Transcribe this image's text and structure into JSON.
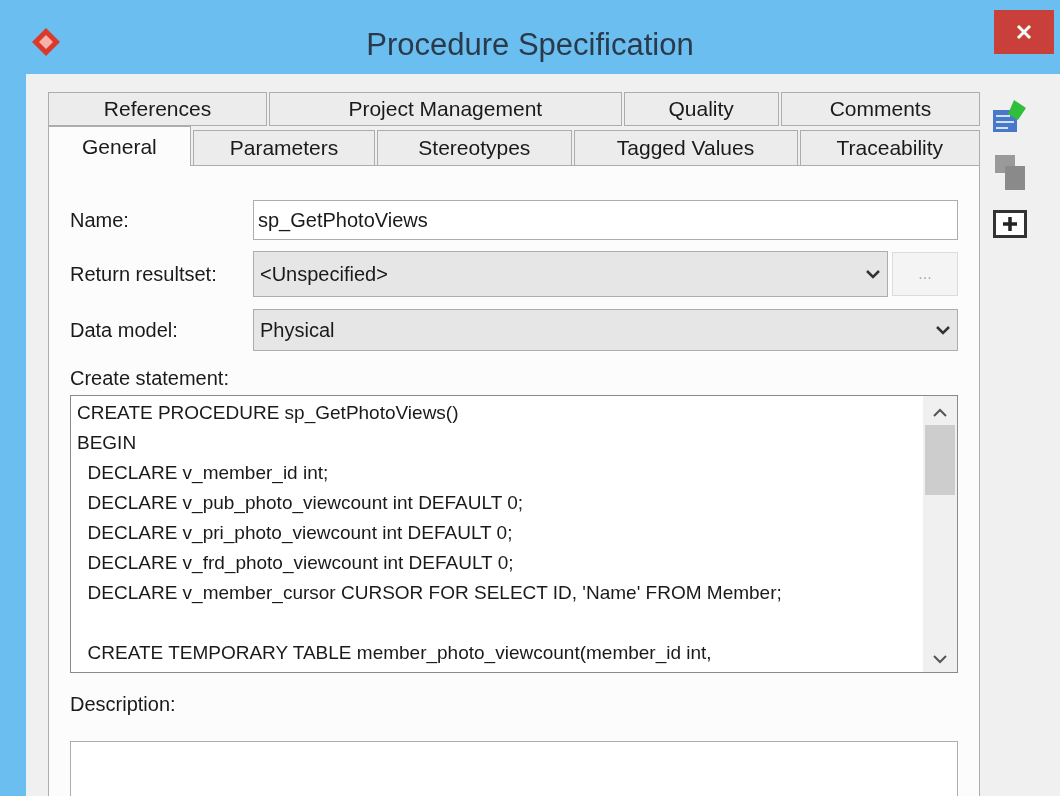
{
  "window": {
    "title": "Procedure Specification"
  },
  "tabs_back": [
    {
      "label": "References",
      "selected": false
    },
    {
      "label": "Project Management",
      "selected": false
    },
    {
      "label": "Quality",
      "selected": false
    },
    {
      "label": "Comments",
      "selected": false
    }
  ],
  "tabs_front": [
    {
      "label": "General",
      "selected": true
    },
    {
      "label": "Parameters",
      "selected": false
    },
    {
      "label": "Stereotypes",
      "selected": false
    },
    {
      "label": "Tagged Values",
      "selected": false
    },
    {
      "label": "Traceability",
      "selected": false
    }
  ],
  "form": {
    "name_label": "Name:",
    "name_value": "sp_GetPhotoViews",
    "resultset_label": "Return resultset:",
    "resultset_value": "<Unspecified>",
    "resultset_button": "...",
    "resultset_button_disabled": true,
    "model_label": "Data model:",
    "model_value": "Physical",
    "statement_label": "Create statement:",
    "statement": "CREATE PROCEDURE sp_GetPhotoViews()\nBEGIN\n  DECLARE v_member_id int;\n  DECLARE v_pub_photo_viewcount int DEFAULT 0;\n  DECLARE v_pri_photo_viewcount int DEFAULT 0;\n  DECLARE v_frd_photo_viewcount int DEFAULT 0;\n  DECLARE v_member_cursor CURSOR FOR SELECT ID, 'Name' FROM Member;\n\n  CREATE TEMPORARY TABLE member_photo_viewcount(member_id int,",
    "description_label": "Description:"
  }
}
